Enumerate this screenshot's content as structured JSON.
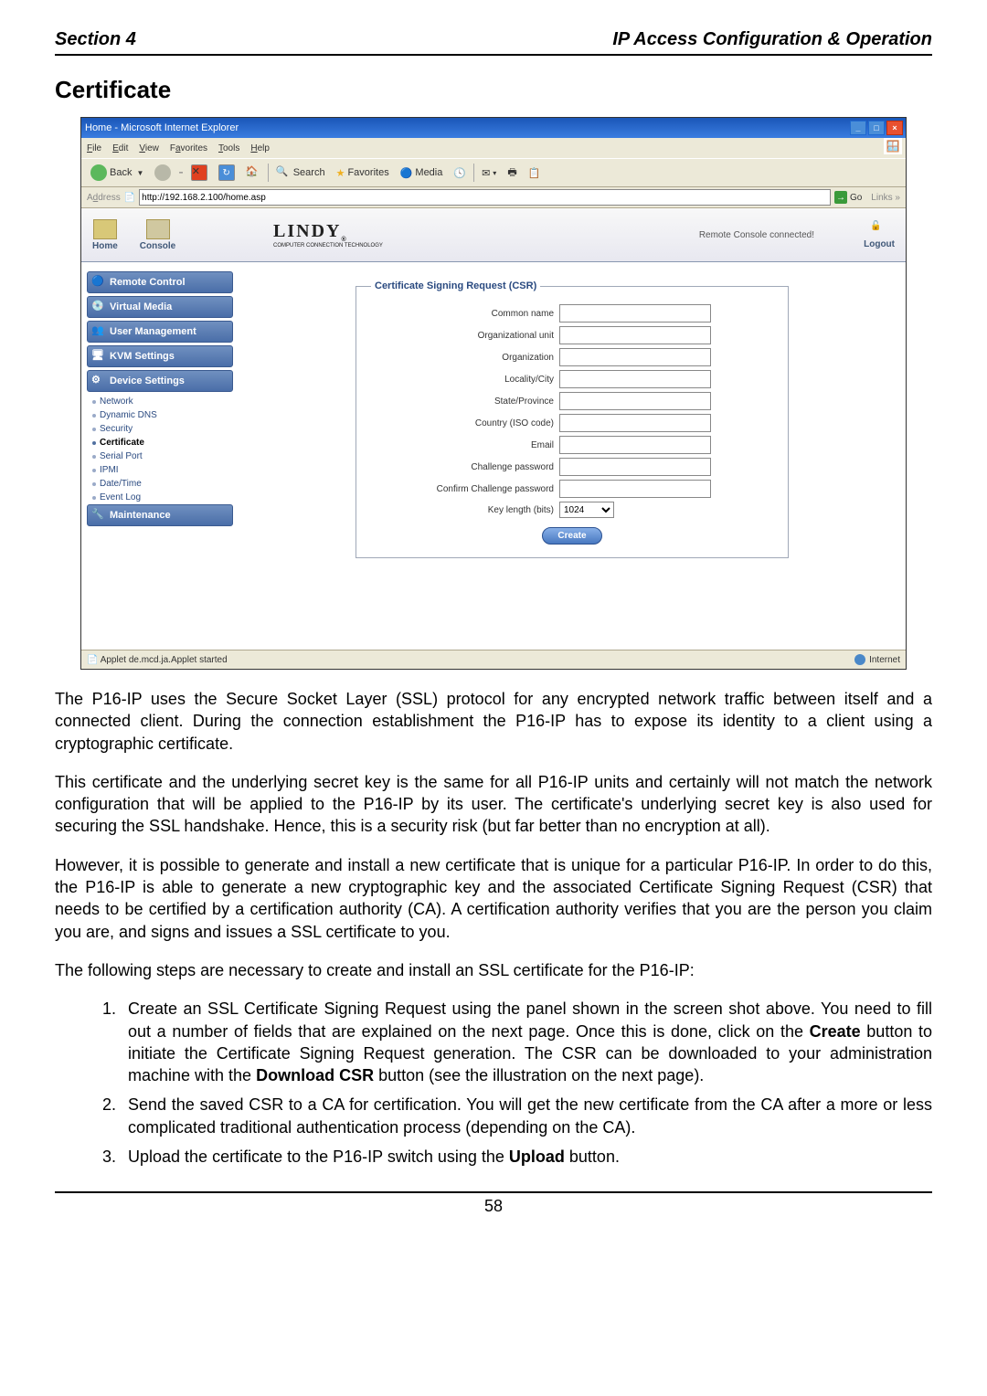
{
  "header": {
    "left": "Section 4",
    "right": "IP Access Configuration & Operation"
  },
  "title": "Certificate",
  "ie": {
    "titlebar": "Home - Microsoft Internet Explorer",
    "menu": {
      "file": "File",
      "edit": "Edit",
      "view": "View",
      "favorites": "Favorites",
      "tools": "Tools",
      "help": "Help"
    },
    "toolbar": {
      "back": "Back",
      "search": "Search",
      "favorites": "Favorites",
      "media": "Media"
    },
    "addrlabel": "Address",
    "url": "http://192.168.2.100/home.asp",
    "go": "Go",
    "links": "Links",
    "status": "Applet de.mcd.ja.Applet started",
    "zone": "Internet"
  },
  "kvm": {
    "brand": "LINDY",
    "brandsub": "COMPUTER CONNECTION TECHNOLOGY",
    "home": "Home",
    "console": "Console",
    "remote": "Remote Console connected!",
    "logout": "Logout",
    "nav": [
      "Remote Control",
      "Virtual Media",
      "User Management",
      "KVM Settings",
      "Device Settings"
    ],
    "sub": [
      "Network",
      "Dynamic DNS",
      "Security",
      "Certificate",
      "Serial Port",
      "IPMI",
      "Date/Time",
      "Event Log"
    ],
    "nav2": "Maintenance",
    "form": {
      "legend": "Certificate Signing Request (CSR)",
      "common": "Common name",
      "org_unit": "Organizational unit",
      "org": "Organization",
      "locality": "Locality/City",
      "state": "State/Province",
      "country": "Country (ISO code)",
      "email": "Email",
      "challenge": "Challenge password",
      "confirm": "Confirm Challenge password",
      "keylen": "Key length (bits)",
      "keyval": "1024",
      "create": "Create"
    }
  },
  "p1": "The P16-IP uses the Secure Socket Layer (SSL) protocol for any encrypted network traffic between itself and a connected client. During the connection establishment the P16-IP has to expose its identity to a client using a cryptographic certificate.",
  "p2": "This certificate and the underlying secret key is the same for all P16-IP units and certainly will not match the network configuration that will be applied to the P16-IP by its user. The certificate's underlying secret key is also used for securing the SSL handshake. Hence, this is a security risk (but far better than no encryption at all).",
  "p3": "However, it is possible to generate and install a new certificate that is unique for a particular P16-IP. In order to do this, the P16-IP is able to generate a new cryptographic key and the associated Certificate Signing Request (CSR) that needs to be certified by a certification authority (CA). A certification authority verifies that you are the person you claim you are, and signs and issues a SSL certificate to you.",
  "p4": "The following steps are necessary to create and install an SSL certificate for the P16-IP:",
  "steps": {
    "1a": "Create an SSL Certificate Signing Request using the panel shown in the screen shot above. You need to fill out a number of fields that are explained on the next page. Once this is done, click on the ",
    "1b": "Create",
    "1c": " button to initiate the Certificate Signing Request generation. The CSR can be downloaded to your administration machine with the ",
    "1d": "Download CSR",
    "1e": " button (see the illustration on the next page).",
    "2": "Send the saved CSR to a CA for certification. You will get the new certificate from the CA after a more or less complicated traditional authentication process (depending on the CA).",
    "3a": "Upload the certificate to the P16-IP switch using the ",
    "3b": "Upload",
    "3c": " button."
  },
  "pagenum": "58"
}
